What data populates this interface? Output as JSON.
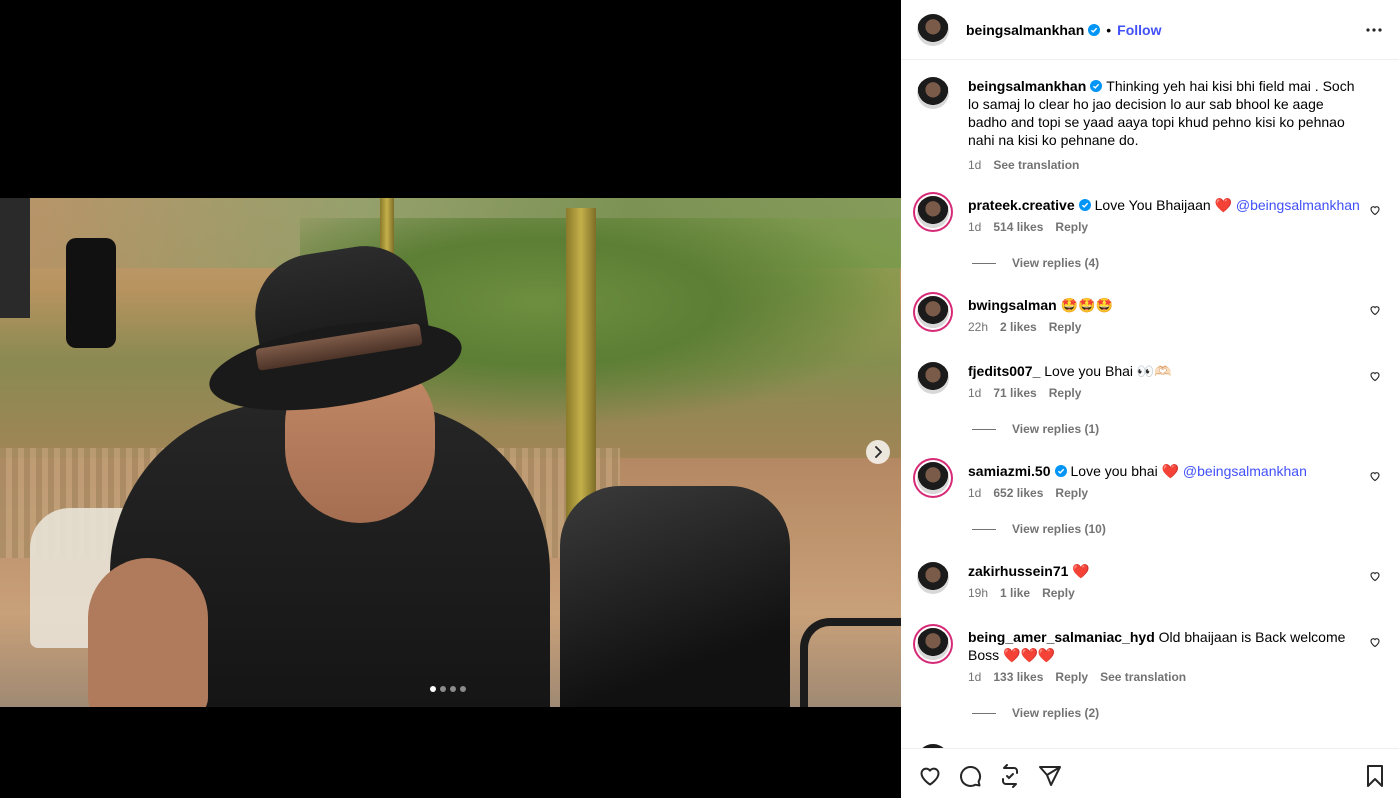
{
  "media": {
    "carousel_count": 4,
    "carousel_active": 1
  },
  "post": {
    "username": "beingsalmankhan",
    "follow_label": "Follow",
    "separator": "•"
  },
  "caption": {
    "username": "beingsalmankhan",
    "text": "Thinking yeh hai kisi bhi field mai . Soch lo samaj lo clear ho jao decision lo aur sab bhool ke aage badho and topi se yaad aaya topi khud pehno kisi ko pehnao nahi na kisi ko pehnane do.",
    "time": "1d",
    "see_translation": "See translation"
  },
  "comments": [
    {
      "username": "prateek.creative",
      "verified": true,
      "text": "Love You Bhaijaan",
      "emoji": "❤️",
      "mention": "@beingsalmankhan",
      "time": "1d",
      "likes": "514 likes",
      "reply": "Reply",
      "view_replies": "View replies (4)"
    },
    {
      "username": "bwingsalman",
      "verified": false,
      "text": "",
      "emoji": "🤩🤩🤩",
      "mention": "",
      "time": "22h",
      "likes": "2 likes",
      "reply": "Reply",
      "view_replies": ""
    },
    {
      "username": "fjedits007_",
      "verified": false,
      "text": "Love you Bhai",
      "emoji": "👀🫶🏻",
      "mention": "",
      "time": "1d",
      "likes": "71 likes",
      "reply": "Reply",
      "view_replies": "View replies (1)"
    },
    {
      "username": "samiazmi.50",
      "verified": true,
      "text": "Love you bhai",
      "emoji": "❤️",
      "mention": "@beingsalmankhan",
      "time": "1d",
      "likes": "652 likes",
      "reply": "Reply",
      "view_replies": "View replies (10)"
    },
    {
      "username": "zakirhussein71",
      "verified": false,
      "text": "",
      "emoji": "❤️",
      "mention": "",
      "time": "19h",
      "likes": "1 like",
      "reply": "Reply",
      "view_replies": ""
    },
    {
      "username": "being_amer_salmaniac_hyd",
      "verified": false,
      "text": "Old bhaijaan is Back welcome Boss",
      "emoji": "❤️❤️❤️",
      "mention": "",
      "time": "1d",
      "likes": "133 likes",
      "reply": "Reply",
      "see_translation": "See translation",
      "view_replies": "View replies (2)"
    }
  ],
  "colors": {
    "accent_link": "#4150f7",
    "verified": "#0095f6",
    "muted": "#737373",
    "heart": "#ed4956"
  },
  "icons": [
    "verified-badge-icon",
    "more-options-icon",
    "heart-icon",
    "comment-icon",
    "repost-icon",
    "share-icon",
    "bookmark-icon",
    "chevron-right-icon"
  ]
}
